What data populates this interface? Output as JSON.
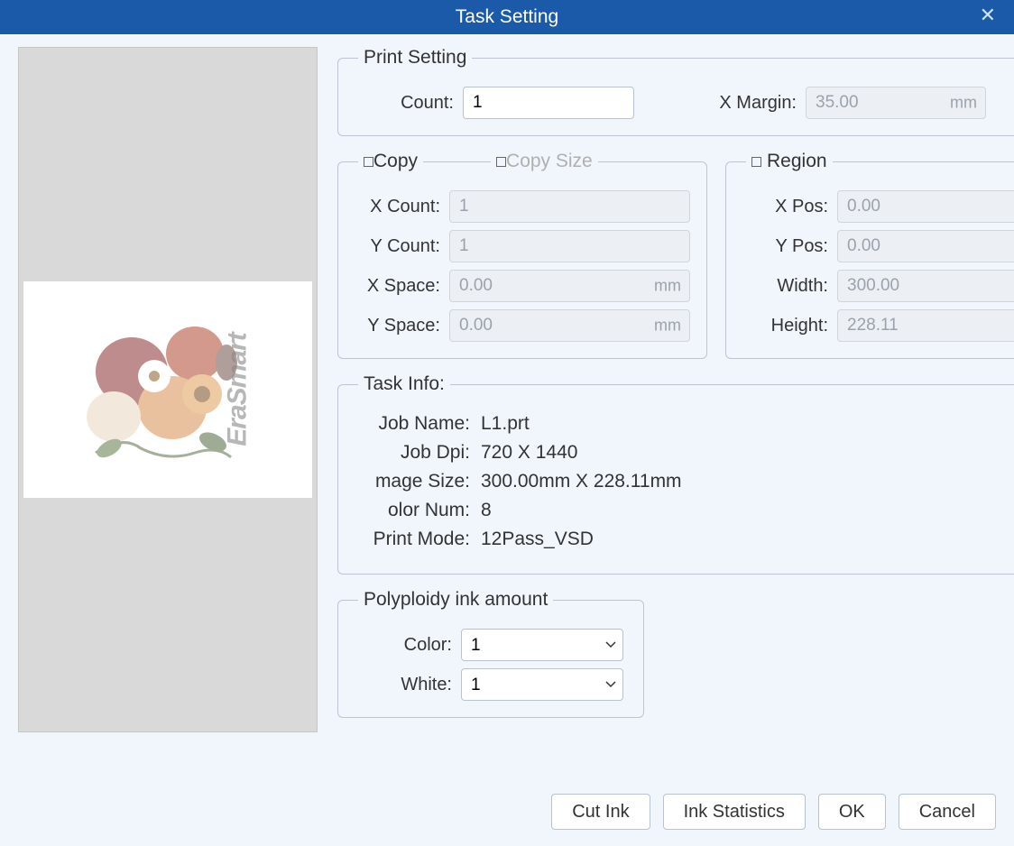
{
  "title": "Task Setting",
  "printSetting": {
    "legend": "Print Setting",
    "countLabel": "Count:",
    "countValue": "1",
    "xMarginLabel": "X Margin:",
    "xMarginValue": "35.00",
    "unit": "mm"
  },
  "copy": {
    "legend": "Copy",
    "sizeLegend": "Copy Size",
    "xCountLabel": "X Count:",
    "xCountValue": "1",
    "yCountLabel": "Y Count:",
    "yCountValue": "1",
    "xSpaceLabel": "X Space:",
    "xSpaceValue": "0.00",
    "ySpaceLabel": "Y Space:",
    "ySpaceValue": "0.00",
    "unit": "mm"
  },
  "region": {
    "legend": "Region",
    "xPosLabel": "X Pos:",
    "xPosValue": "0.00",
    "yPosLabel": "Y Pos:",
    "yPosValue": "0.00",
    "widthLabel": "Width:",
    "widthValue": "300.00",
    "heightLabel": "Height:",
    "heightValue": "228.11",
    "unit": "mm"
  },
  "taskInfo": {
    "legend": "Task Info:",
    "jobNameLabel": "Job Name:",
    "jobNameValue": "L1.prt",
    "jobDpiLabel": "Job Dpi:",
    "jobDpiValue": "720 X 1440",
    "imageSizeLabel": "mage Size:",
    "imageSizeValue": "300.00mm X 228.11mm",
    "colorNumLabel": "olor Num:",
    "colorNumValue": "8",
    "printModeLabel": "Print Mode:",
    "printModeValue": "12Pass_VSD"
  },
  "inkAmount": {
    "legend": "Polyploidy ink amount",
    "colorLabel": "Color:",
    "colorValue": "1",
    "whiteLabel": "White:",
    "whiteValue": "1"
  },
  "buttons": {
    "cutInk": "Cut Ink",
    "inkStats": "Ink Statistics",
    "ok": "OK",
    "cancel": "Cancel"
  },
  "watermark": "EraSmart"
}
